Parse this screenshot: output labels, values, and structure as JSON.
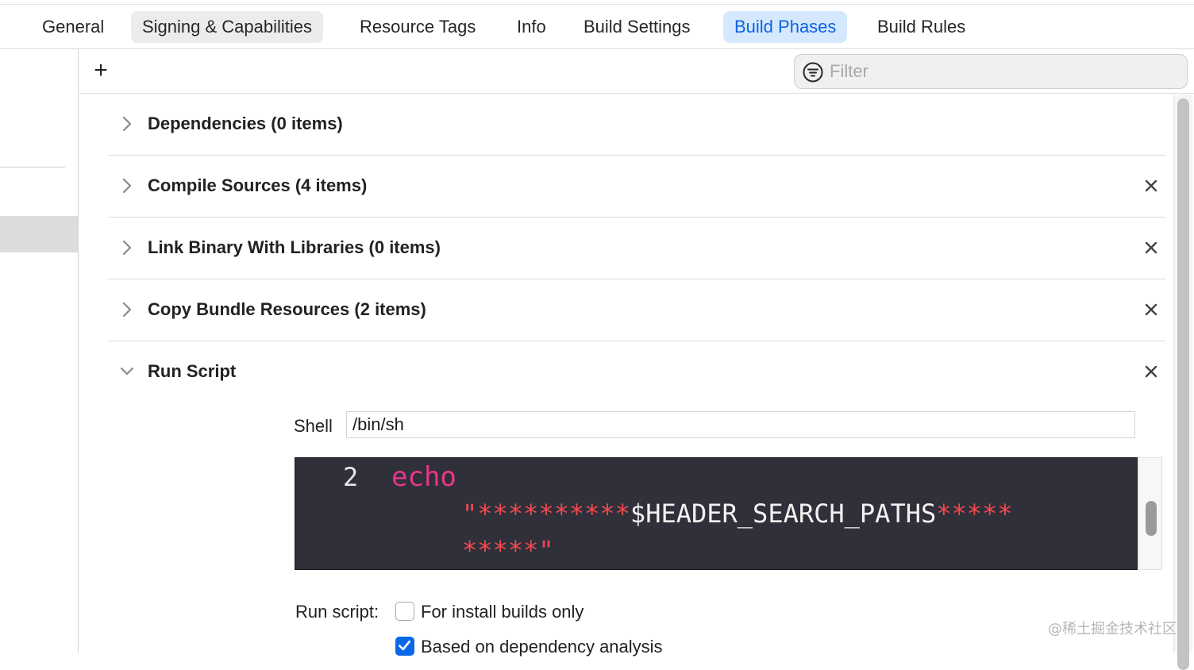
{
  "tabs": [
    {
      "label": "General",
      "state": "normal"
    },
    {
      "label": "Signing & Capabilities",
      "state": "hover"
    },
    {
      "label": "Resource Tags",
      "state": "normal"
    },
    {
      "label": "Info",
      "state": "normal"
    },
    {
      "label": "Build Settings",
      "state": "normal"
    },
    {
      "label": "Build Phases",
      "state": "active"
    },
    {
      "label": "Build Rules",
      "state": "normal"
    }
  ],
  "toolbar": {
    "add_label": "+",
    "filter_placeholder": "Filter",
    "filter_icon": "filter-icon"
  },
  "phases": [
    {
      "title": "Dependencies (0 items)",
      "expanded": false,
      "removable": false
    },
    {
      "title": "Compile Sources (4 items)",
      "expanded": false,
      "removable": true
    },
    {
      "title": "Link Binary With Libraries (0 items)",
      "expanded": false,
      "removable": true
    },
    {
      "title": "Copy Bundle Resources (2 items)",
      "expanded": false,
      "removable": true
    }
  ],
  "run_script": {
    "title": "Run Script",
    "expanded": true,
    "shell_label": "Shell",
    "shell_value": "/bin/sh",
    "script": {
      "line_number": "2",
      "keyword": "echo",
      "line2_quote": "\"",
      "line2_stars": "**********",
      "line2_var": "$HEADER_SEARCH_PATHS",
      "line2_stars_end": "*****",
      "line3_stars": "*****",
      "line3_quote": "\""
    },
    "run_script_label": "Run script:",
    "options": [
      {
        "label": "For install builds only",
        "checked": false
      },
      {
        "label": "Based on dependency analysis",
        "checked": true
      }
    ]
  },
  "watermark": "@稀土掘金技术社区",
  "colors": {
    "accent": "#0a64e6",
    "active_tab_bg": "#d6e8fd",
    "editor_bg": "#2f3039",
    "keyword": "#e8368a",
    "string": "#f0494f"
  }
}
